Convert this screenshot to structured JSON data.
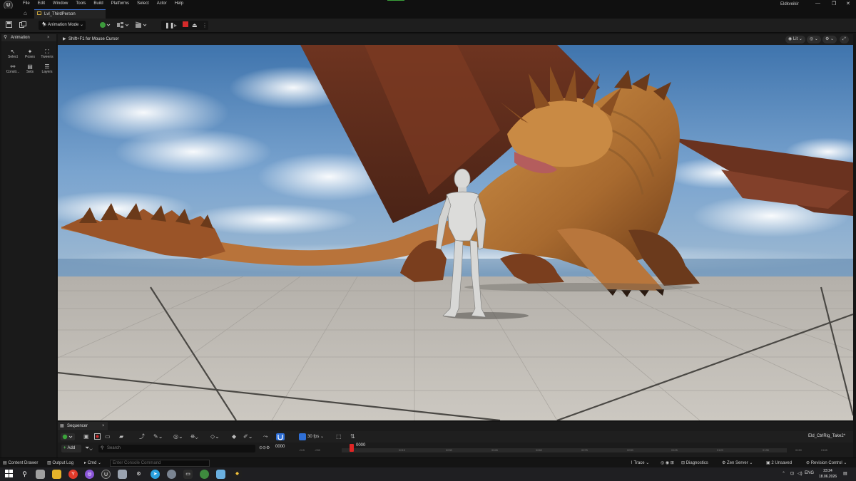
{
  "menubar": {
    "logo": "U",
    "menus": [
      "File",
      "Edit",
      "Window",
      "Tools",
      "Build",
      "Platforms",
      "Select",
      "Actor",
      "Help"
    ],
    "user": "Eldkveikir",
    "window_controls": {
      "minimize": "—",
      "maximize": "❐",
      "close": "✕"
    }
  },
  "level_tab": {
    "label": "Lvl_ThirdPerson",
    "home_icon": "⌂"
  },
  "toolbar": {
    "mode_label": "Animation Mode",
    "mode_chevron": "⌄"
  },
  "left_panel": {
    "title": "Animation",
    "close": "×",
    "tools": [
      {
        "label": "Select",
        "icon": "select-icon"
      },
      {
        "label": "Poses",
        "icon": "poses-icon"
      },
      {
        "label": "Tweens",
        "icon": "tweens-icon"
      },
      {
        "label": "Constr...",
        "icon": "constraints-icon"
      },
      {
        "label": "Sets",
        "icon": "sets-icon"
      },
      {
        "label": "Layers",
        "icon": "layers-icon"
      }
    ]
  },
  "viewport": {
    "hint": "Shift+F1 for Mouse Cursor",
    "lit_label": "Lit"
  },
  "sequencer": {
    "tab_label": "Sequencer",
    "close": "×",
    "fps_label": "30 fps",
    "sequence_name": "Eld_CtrlRig_Take2*",
    "add_label": "Add",
    "search_placeholder": "Search",
    "current_frame": "0000",
    "playhead_label": "0000",
    "ruler_ticks": [
      "-015",
      "-030",
      "0015",
      "0030",
      "0045",
      "0060",
      "0075",
      "0090",
      "0105",
      "0120",
      "0135",
      "0150",
      "0165"
    ]
  },
  "statusbar": {
    "content_drawer": "Content Drawer",
    "output_log": "Output Log",
    "cmd": "Cmd",
    "console_placeholder": "Enter Console Command",
    "trace": "Trace",
    "diagnostics": "Diagnostics",
    "zen_server": "Zen Server",
    "unsaved": "2 Unsaved",
    "revision_control": "Revision Control"
  },
  "taskbar": {
    "lang": "ENG",
    "time": "23:24",
    "date": "18.06.2026"
  },
  "colors": {
    "accent_blue": "#2f6fd6",
    "playhead_red": "#e02525",
    "record_red": "#d42a2a",
    "sky_top": "#3f74ad",
    "floor": "#c8c3bb"
  }
}
